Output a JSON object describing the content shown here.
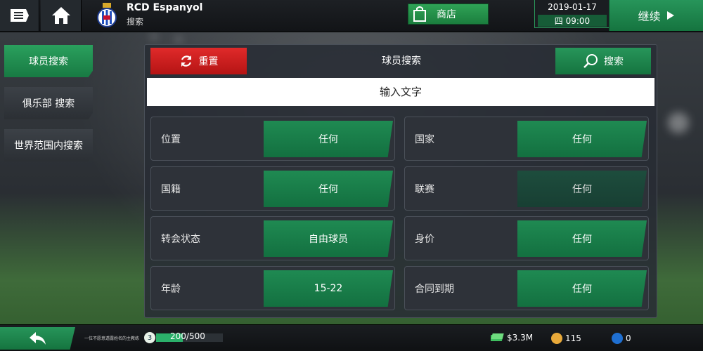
{
  "header": {
    "club_name": "RCD Espanyol",
    "subtitle": "搜索",
    "shop_label": "商店",
    "date": "2019-01-17",
    "weekday_time": "四 09:00",
    "continue_label": "继续"
  },
  "sidebar": {
    "items": [
      {
        "label": "球员搜索",
        "active": true
      },
      {
        "label": "俱乐部 搜索",
        "active": false
      },
      {
        "label": "世界范围内搜索",
        "active": false
      }
    ]
  },
  "panel": {
    "reset_label": "重置",
    "title": "球员搜索",
    "search_label": "搜索",
    "input_placeholder": "输入文字",
    "filters": [
      {
        "label": "位置",
        "value": "任何"
      },
      {
        "label": "国家",
        "value": "任何"
      },
      {
        "label": "国籍",
        "value": "任何"
      },
      {
        "label": "联赛",
        "value": "任何"
      },
      {
        "label": "转会状态",
        "value": "自由球员"
      },
      {
        "label": "身价",
        "value": "任何"
      },
      {
        "label": "年龄",
        "value": "15-22"
      },
      {
        "label": "合同到期",
        "value": "任何"
      }
    ]
  },
  "footer": {
    "coach_note": "一位不愿意透露姓名的主教练",
    "level": "3",
    "xp_text": "200/500",
    "xp_fraction": 0.4,
    "money": "$3.3M",
    "coins": "115",
    "gems": "0"
  },
  "colors": {
    "accent_green": "#1f8a52",
    "reset_red": "#d61f1f"
  },
  "icons": [
    "menu-icon",
    "home-icon",
    "club-crest-icon",
    "shop-bag-icon",
    "arrow-right-icon",
    "refresh-icon",
    "search-icon",
    "back-arrow-icon",
    "money-icon",
    "coin-icon",
    "gem-icon"
  ]
}
